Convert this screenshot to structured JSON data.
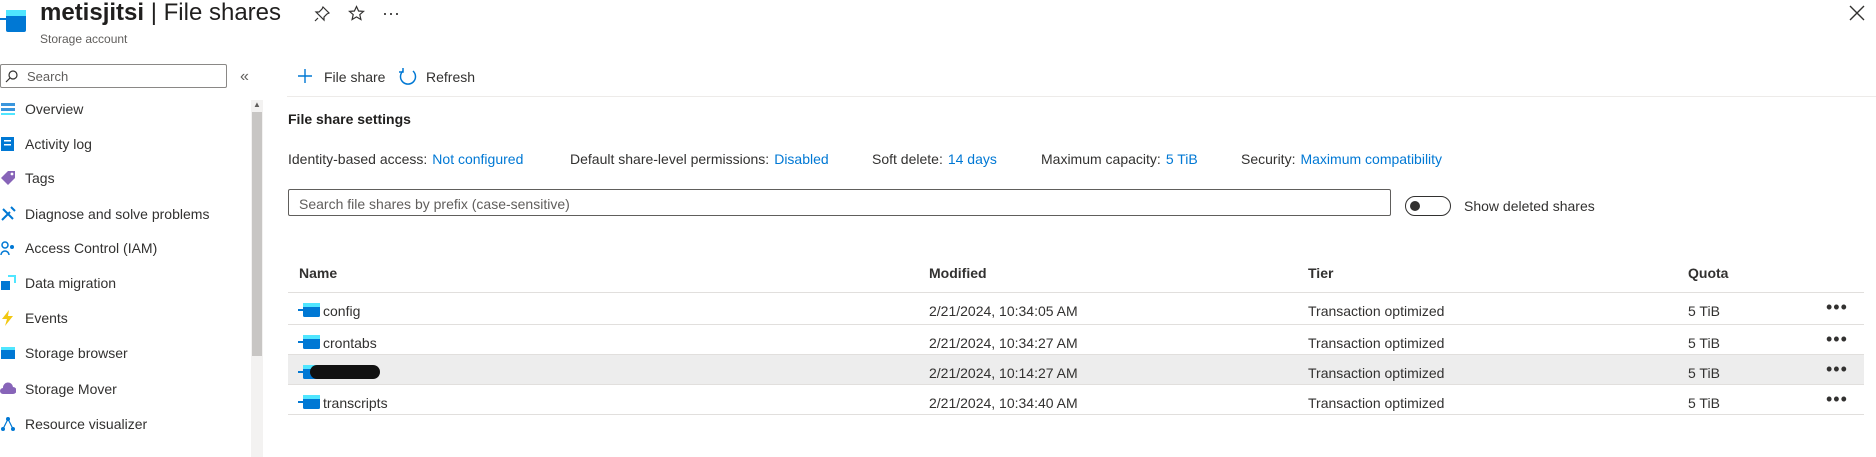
{
  "header": {
    "resource_name": "metisjitsi",
    "separator": " | ",
    "page_name": "File shares",
    "subtitle": "Storage account",
    "more_label": "···"
  },
  "sidebar": {
    "search_placeholder": "Search",
    "collapse_label": "«",
    "items": [
      {
        "label": "Overview",
        "icon": "overview-icon",
        "color": "#3a96dd"
      },
      {
        "label": "Activity log",
        "icon": "activity-log-icon",
        "color": "#0078d4"
      },
      {
        "label": "Tags",
        "icon": "tag-icon",
        "color": "#8764b8"
      },
      {
        "label": "Diagnose and solve problems",
        "icon": "wrench-icon",
        "color": "#0078d4"
      },
      {
        "label": "Access Control (IAM)",
        "icon": "people-icon",
        "color": "#0078d4"
      },
      {
        "label": "Data migration",
        "icon": "data-migration-icon",
        "color": "#0078d4"
      },
      {
        "label": "Events",
        "icon": "lightning-icon",
        "color": "#f2c811"
      },
      {
        "label": "Storage browser",
        "icon": "storage-browser-icon",
        "color": "#0078d4"
      },
      {
        "label": "Storage Mover",
        "icon": "cloud-icon",
        "color": "#8764b8"
      },
      {
        "label": "Resource visualizer",
        "icon": "network-icon",
        "color": "#0078d4"
      }
    ]
  },
  "toolbar": {
    "add_label": "File share",
    "refresh_label": "Refresh"
  },
  "settings": {
    "heading": "File share settings",
    "identity_key": "Identity-based access:",
    "identity_value": "Not configured",
    "permissions_key": "Default share-level permissions:",
    "permissions_value": "Disabled",
    "soft_delete_key": "Soft delete:",
    "soft_delete_value": "14 days",
    "capacity_key": "Maximum capacity:",
    "capacity_value": "5 TiB",
    "security_key": "Security:",
    "security_value": "Maximum compatibility"
  },
  "filter": {
    "placeholder": "Search file shares by prefix (case-sensitive)",
    "show_deleted_label": "Show deleted shares",
    "show_deleted_on": false
  },
  "table": {
    "columns": [
      "Name",
      "Modified",
      "Tier",
      "Quota"
    ],
    "rows": [
      {
        "name": "config",
        "modified": "2/21/2024, 10:34:05 AM",
        "tier": "Transaction optimized",
        "quota": "5 TiB"
      },
      {
        "name": "crontabs",
        "modified": "2/21/2024, 10:34:27 AM",
        "tier": "Transaction optimized",
        "quota": "5 TiB"
      },
      {
        "name": "",
        "modified": "2/21/2024, 10:14:27 AM",
        "tier": "Transaction optimized",
        "quota": "5 TiB"
      },
      {
        "name": "transcripts",
        "modified": "2/21/2024, 10:34:40 AM",
        "tier": "Transaction optimized",
        "quota": "5 TiB"
      }
    ],
    "row_more_label": "•••"
  },
  "colors": {
    "accent": "#0078d4",
    "link": "#0078d4",
    "selected_row": "#ededed"
  }
}
